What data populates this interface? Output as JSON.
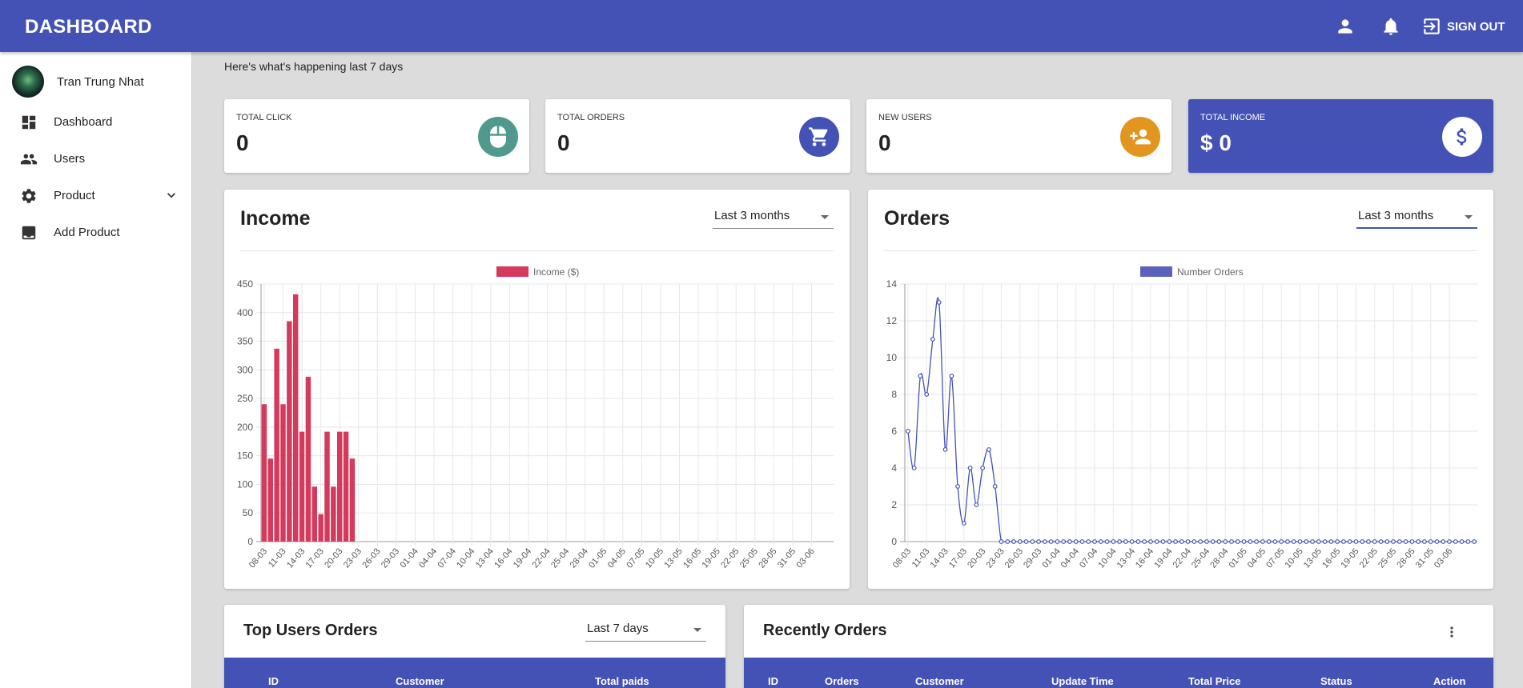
{
  "header": {
    "title": "DASHBOARD",
    "signout_label": "SIGN OUT"
  },
  "sidebar": {
    "user_name": "Tran Trung Nhat",
    "items": [
      {
        "label": "Dashboard",
        "icon": "dashboard-icon"
      },
      {
        "label": "Users",
        "icon": "people-icon"
      },
      {
        "label": "Product",
        "icon": "gear-icon"
      },
      {
        "label": "Add Product",
        "icon": "add-box-icon"
      }
    ]
  },
  "main": {
    "subtitle": "Here's what's happening last 7 days"
  },
  "stats": [
    {
      "label": "TOTAL CLICK",
      "value": "0",
      "icon": "mouse-icon",
      "color": "#4f9a8c"
    },
    {
      "label": "TOTAL ORDERS",
      "value": "0",
      "icon": "cart-icon",
      "color": "#4552b5"
    },
    {
      "label": "NEW USERS",
      "value": "0",
      "icon": "add-user-icon",
      "color": "#e3961f"
    },
    {
      "label": "TOTAL INCOME",
      "value": "$ 0",
      "icon": "dollar-icon",
      "color": "#ffffff"
    }
  ],
  "income_panel": {
    "title": "Income",
    "range": "Last 3 months"
  },
  "orders_panel": {
    "title": "Orders",
    "range": "Last 3 months"
  },
  "top_users": {
    "title": "Top Users Orders",
    "range": "Last 7 days",
    "columns": [
      "ID",
      "Customer",
      "Total paids"
    ]
  },
  "recent_orders": {
    "title": "Recently Orders",
    "columns": [
      "ID",
      "Orders",
      "Customer",
      "Update Time",
      "Total Price",
      "Status",
      "Action"
    ]
  },
  "colors": {
    "primary": "#4552b5",
    "income_bar": "#d5395b",
    "orders_line": "#4552b5"
  },
  "chart_data": [
    {
      "type": "bar",
      "legend": "Income ($)",
      "ylim": [
        0,
        450
      ],
      "yticks": [
        0,
        50,
        100,
        150,
        200,
        250,
        300,
        350,
        400,
        450
      ],
      "xtick_labels": [
        "08-03",
        "11-03",
        "14-03",
        "17-03",
        "20-03",
        "23-03",
        "26-03",
        "29-03",
        "01-04",
        "04-04",
        "07-04",
        "10-04",
        "13-04",
        "16-04",
        "19-04",
        "22-04",
        "25-04",
        "28-04",
        "01-05",
        "04-05",
        "07-05",
        "10-05",
        "13-05",
        "16-05",
        "19-05",
        "22-05",
        "25-05",
        "28-05",
        "31-05",
        "03-06"
      ],
      "values": [
        240,
        145,
        337,
        240,
        385,
        432,
        192,
        288,
        96,
        48,
        192,
        96,
        192,
        192,
        145
      ],
      "grid": true,
      "legend_position": "top"
    },
    {
      "type": "line",
      "legend": "Number Orders",
      "ylim": [
        0,
        14
      ],
      "yticks": [
        0,
        2,
        4,
        6,
        8,
        10,
        12,
        14
      ],
      "xtick_labels": [
        "08-03",
        "11-03",
        "14-03",
        "17-03",
        "20-03",
        "23-03",
        "26-03",
        "29-03",
        "01-04",
        "04-04",
        "07-04",
        "10-04",
        "13-04",
        "16-04",
        "19-04",
        "22-04",
        "25-04",
        "28-04",
        "01-05",
        "04-05",
        "07-05",
        "10-05",
        "13-05",
        "16-05",
        "19-05",
        "22-05",
        "25-05",
        "28-05",
        "31-05",
        "03-06"
      ],
      "values": [
        6,
        4,
        9,
        8,
        11,
        13,
        5,
        9,
        3,
        1,
        4,
        2,
        4,
        5,
        3,
        0
      ],
      "total_points": 92,
      "grid": true,
      "legend_position": "top"
    }
  ]
}
